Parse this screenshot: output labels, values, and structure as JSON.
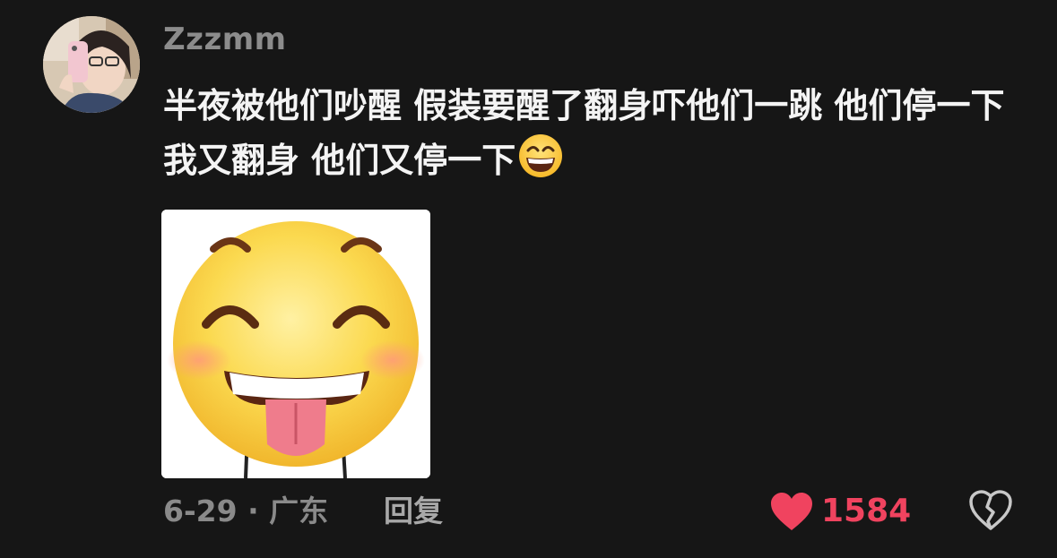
{
  "comment": {
    "username": "Zzzmm",
    "text": "半夜被他们吵醒 假装要醒了翻身吓他们一跳 他们停一下 我又翻身 他们又停一下",
    "inline_emoji": "grinning-face-emoji",
    "sticker_icon": "tongue-out-smiley-sticker",
    "date_location": "6-29 · 广东",
    "reply_label": "回复",
    "like_count": "1584",
    "colors": {
      "background": "#161616",
      "like": "#f0435f",
      "meta": "#8a8a8a"
    }
  }
}
